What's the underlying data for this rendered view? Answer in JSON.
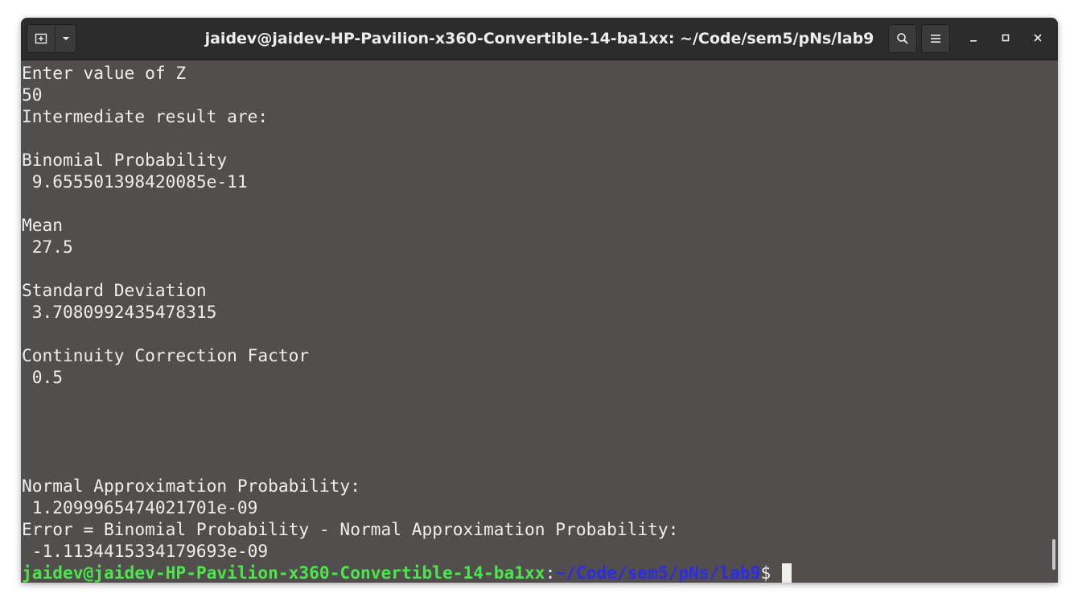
{
  "window": {
    "title": "jaidev@jaidev-HP-Pavilion-x360-Convertible-14-ba1xx: ~/Code/sem5/pNs/lab9"
  },
  "header": {
    "new_tab_icon": "new-tab-icon",
    "menu_dropdown_icon": "chevron-down-icon",
    "search_icon": "search-icon",
    "hamburger_icon": "hamburger-menu-icon",
    "minimize_icon": "minimize-icon",
    "maximize_icon": "maximize-icon",
    "close_icon": "close-icon"
  },
  "terminal": {
    "lines": [
      "Enter value of Z",
      "50",
      "Intermediate result are:",
      "",
      "Binomial Probability",
      " 9.655501398420085e-11",
      "",
      "Mean",
      " 27.5",
      "",
      "Standard Deviation",
      " 3.7080992435478315",
      "",
      "Continuity Correction Factor",
      " 0.5",
      "",
      "",
      "",
      "",
      "Normal Approximation Probability:",
      " 1.2099965474021701e-09",
      "Error = Binomial Probability - Normal Approximation Probability:",
      " -1.1134415334179693e-09"
    ],
    "prompt": {
      "user_host": "jaidev@jaidev-HP-Pavilion-x360-Convertible-14-ba1xx",
      "colon": ":",
      "path": "~/Code/sem5/pNs/lab9",
      "symbol": "$"
    }
  },
  "colors": {
    "terminal_bg": "#524e4d",
    "titlebar_bg": "#2c2c2c",
    "text": "#eeeeec",
    "prompt_user": "#4ce64c",
    "prompt_path": "#2b2be8"
  }
}
